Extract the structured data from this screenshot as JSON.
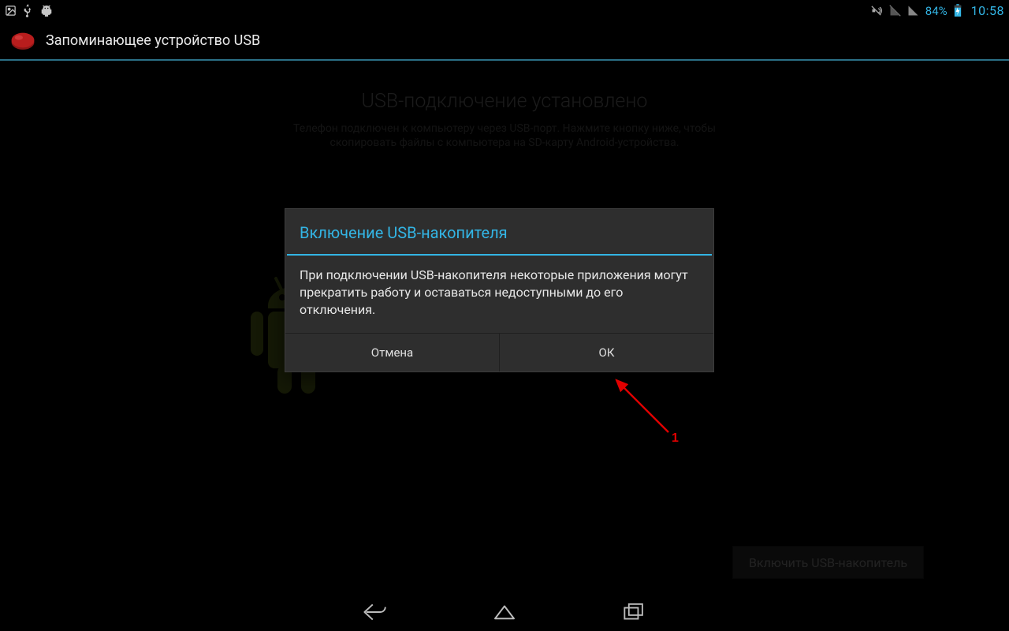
{
  "statusbar": {
    "battery": "84%",
    "clock": "10:58"
  },
  "actionbar": {
    "title": "Запоминающее устройство USB"
  },
  "page": {
    "headline": "USB-подключение установлено",
    "subline": "Телефон подключен к компьютеру через USB-порт. Нажмите кнопку ниже, чтобы скопировать файлы с компьютера на SD-карту Android-устройства.",
    "enable_button": "Включить USB-накопитель"
  },
  "dialog": {
    "title": "Включение USB-накопителя",
    "body": "При подключении USB-накопителя некоторые приложения могут прекратить работу и оставаться недоступными до его отключения.",
    "cancel": "Отмена",
    "ok": "ОК"
  },
  "annotation": {
    "label": "1"
  }
}
